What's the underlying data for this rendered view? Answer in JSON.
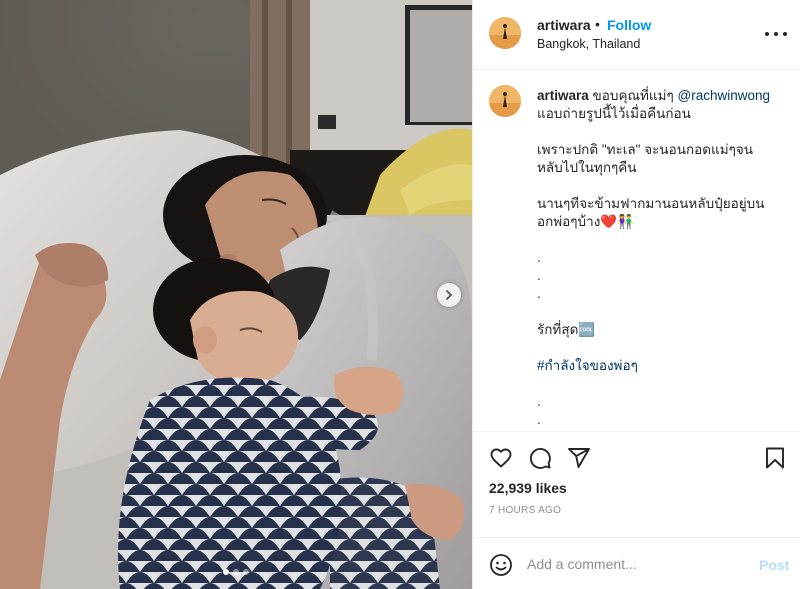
{
  "post": {
    "username": "artiwara",
    "header_separator": "•",
    "follow_label": "Follow",
    "location": "Bangkok, Thailand",
    "more_icon": "more-options-icon"
  },
  "caption": {
    "username": "artiwara",
    "line1_text": "ขอบคุณที่แม่ๆ",
    "mention": "@rachwinwong",
    "line2": "แอบถ่ายรูปนี้ไว้เมื่อคืนก่อน",
    "line3": "เพราะปกติ \"ทะเล\" จะนอนกอดแม่ๆจน",
    "line4": "หลับไปในทุกๆคืน",
    "line5": "นานๆทีจะข้ามฟากมานอนหลับปุ๋ยอยู่บน",
    "line6": "อกพ่อๆบ้าง❤️👫",
    "dot1": ".",
    "dot2": ".",
    "dot3": ".",
    "line7": "รักที่สุด🆒",
    "hashtag": "#กำลังใจของพ่อๆ",
    "dot4": ".",
    "dot5": "."
  },
  "actions": {
    "like_icon": "heart-icon",
    "comment_icon": "comment-icon",
    "share_icon": "share-icon",
    "save_icon": "bookmark-icon",
    "likes_text": "22,939 likes",
    "time_text": "7 HOURS AGO"
  },
  "add_comment": {
    "placeholder": "Add a comment...",
    "post_label": "Post",
    "emoji_icon": "emoji-icon"
  },
  "carousel": {
    "total": 3,
    "active": 1
  },
  "colors": {
    "follow_blue": "#0095f6",
    "link_blue": "#00376b",
    "post_disabled": "#b2dffc",
    "muted": "#8e8e8e",
    "border": "#efefef"
  }
}
